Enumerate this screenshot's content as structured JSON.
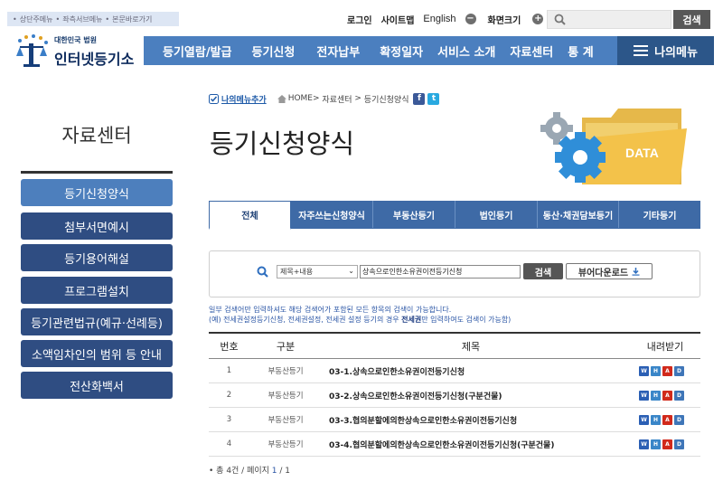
{
  "skip_links": [
    "상단주메뉴",
    "좌측서브메뉴",
    "본문바로가기"
  ],
  "util": {
    "login": "로그인",
    "sitemap": "사이트맵",
    "english": "English",
    "zoom_label": "화면크기",
    "search_button": "검색",
    "search_placeholder": ""
  },
  "logo": {
    "small": "대한민국 법원",
    "big": "인터넷등기소"
  },
  "gnb": [
    "등기열람/발급",
    "등기신청",
    "전자납부",
    "확정일자",
    "서비스 소개",
    "자료센터",
    "통 계"
  ],
  "my_menu": "나의메뉴",
  "lnb": {
    "title": "자료센터",
    "items": [
      "등기신청양식",
      "첨부서면예시",
      "등기용어해설",
      "프로그램설치",
      "등기관련법규(예규·선례등)",
      "소액임차인의 범위 등 안내",
      "전산화백서"
    ]
  },
  "breadcrumb": {
    "add_label": "나의메뉴추가",
    "home": "HOME",
    "level1": "자료센터",
    "level2": "등기신청양식",
    "facebook": "f",
    "twitter": "t"
  },
  "page_title": "등기신청양식",
  "deco_label": "DATA",
  "tabs": [
    "전체",
    "자주쓰는신청양식",
    "부동산등기",
    "법인등기",
    "동산·채권담보등기",
    "기타등기"
  ],
  "search": {
    "select_value": "제목+내용",
    "keyword": "상속으로인한소유권이전등기신청",
    "search_button": "검색",
    "viewer_button": "뷰어다운로드"
  },
  "notes": {
    "line1": "일부 검색어만 입력하셔도 해당 검색어가 포함된 모든 항목의 검색이 가능합니다.",
    "line2_pre": "(예) 전세권설정등기신청, 전세권설정, 전세권 설정 등기의 경우 ",
    "line2_bold": "전세권",
    "line2_post": "만 입력하여도 검색이 가능함)"
  },
  "table": {
    "headers": [
      "번호",
      "구분",
      "제목",
      "내려받기"
    ],
    "rows": [
      {
        "no": "1",
        "category": "부동산등기",
        "title": "03-1.상속으로인한소유권이전등기신청"
      },
      {
        "no": "2",
        "category": "부동산등기",
        "title": "03-2.상속으로인한소유권이전등기신청(구분건물)"
      },
      {
        "no": "3",
        "category": "부동산등기",
        "title": "03-3.협의분할에의한상속으로인한소유권이전등기신청"
      },
      {
        "no": "4",
        "category": "부동산등기",
        "title": "03-4.협의분할에의한상속으로인한소유권이전등기신청(구분건물)"
      }
    ],
    "file_icons": [
      "word-icon",
      "hwp-icon",
      "pdf-icon",
      "doc-icon"
    ]
  },
  "paging": {
    "total_pre": "총 4건 / 페이지 ",
    "current": "1",
    "sep": " / ",
    "total_pages": "1"
  },
  "colors": {
    "gnb": "#4b7fbf",
    "gnb_dark": "#2c5689",
    "lnb": "#2f4d82",
    "lnb_active": "#4d7fbd",
    "tab": "#3e6aa6",
    "note": "#2a55a5"
  }
}
